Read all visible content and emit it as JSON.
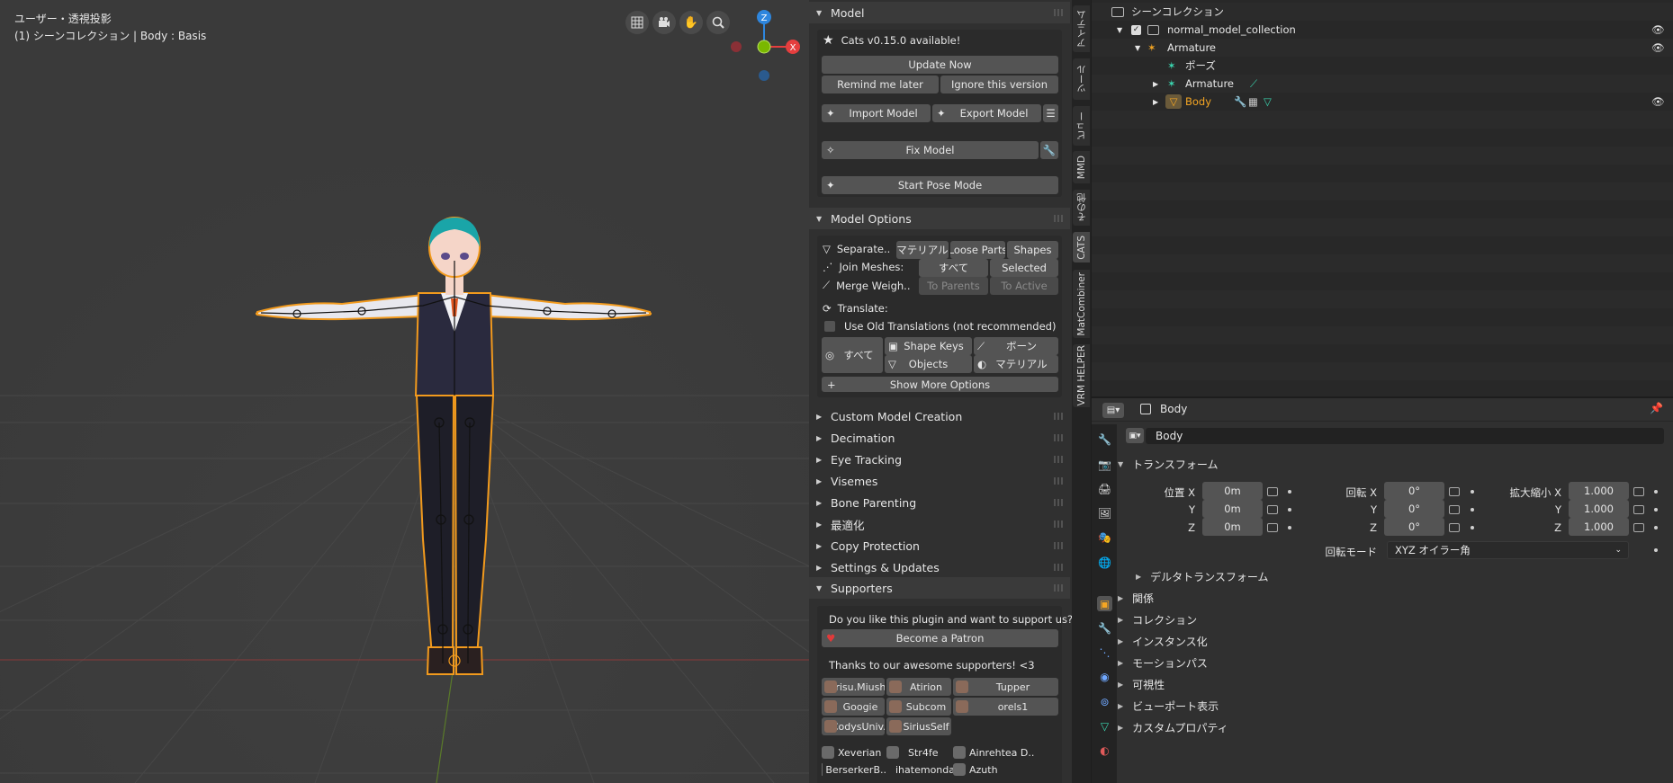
{
  "viewport": {
    "view_name": "ユーザー・透視投影",
    "context": "(1) シーンコレクション | Body : Basis",
    "gizmo": {
      "z": "Z",
      "x": "X"
    }
  },
  "npanel": {
    "model": {
      "header": "Model",
      "update_notice": "Cats v0.15.0 available!",
      "update_now": "Update Now",
      "remind_later": "Remind me later",
      "ignore_version": "Ignore this version",
      "import_model": "Import Model",
      "export_model": "Export Model",
      "fix_model": "Fix Model",
      "start_pose_mode": "Start Pose Mode"
    },
    "model_options": {
      "header": "Model Options",
      "separate_label": "Separate..",
      "separate_material": "マテリアル",
      "separate_loose": "Loose Parts",
      "separate_shapes": "Shapes",
      "join_label": "Join Meshes:",
      "join_all": "すべて",
      "join_selected": "Selected",
      "merge_label": "Merge Weigh..",
      "merge_parents": "To Parents",
      "merge_active": "To Active",
      "translate_label": "Translate:",
      "old_translations": "Use Old Translations (not recommended)",
      "translate_all": "すべて",
      "shape_keys": "Shape Keys",
      "bones": "ボーン",
      "objects": "Objects",
      "materials": "マテリアル",
      "show_more": "Show More Options"
    },
    "collapsed_sections": [
      "Custom Model Creation",
      "Decimation",
      "Eye Tracking",
      "Visemes",
      "Bone Parenting",
      "最適化",
      "Copy Protection",
      "Settings & Updates"
    ],
    "supporters": {
      "header": "Supporters",
      "question": "Do you like this plugin and want to support us?",
      "patron": "Become a Patron",
      "thanks": "Thanks to our awesome supporters! <3",
      "boxed": [
        "Krisu.Miushy",
        "Atirion",
        "Tupper",
        "Googie",
        "Subcom",
        "orels1",
        "CodysUniv..",
        "SiriusSelf"
      ],
      "plain": [
        "Xeverian",
        "Str4fe",
        "Ainrehtea D..",
        "BerserkerB..",
        "ihatemonda..",
        "Azuth"
      ]
    }
  },
  "tabs": [
    "アイテム",
    "ツール",
    "ビュー",
    "MMD",
    "その他",
    "CATS",
    "MatCombiner",
    "VRM HELPER"
  ],
  "outliner": {
    "rows": [
      {
        "label": "シーンコレクション"
      },
      {
        "label": "normal_model_collection"
      },
      {
        "label": "Armature"
      },
      {
        "label": "ポーズ"
      },
      {
        "label": "Armature"
      },
      {
        "label": "Body"
      }
    ]
  },
  "properties": {
    "header_name": "Body",
    "object_name": "Body",
    "transform_header": "トランスフォーム",
    "location_label": "位置 X",
    "rotation_label": "回転 X",
    "scale_label": "拡大縮小 X",
    "y": "Y",
    "z": "Z",
    "loc": [
      "0m",
      "0m",
      "0m"
    ],
    "rot": [
      "0°",
      "0°",
      "0°"
    ],
    "scale": [
      "1.000",
      "1.000",
      "1.000"
    ],
    "rotation_mode_label": "回転モード",
    "rotation_mode": "XYZ オイラー角",
    "delta": "デルタトランスフォーム",
    "sections": [
      "関係",
      "コレクション",
      "インスタンス化",
      "モーションパス",
      "可視性",
      "ビューポート表示",
      "カスタムプロパティ"
    ]
  },
  "colors": {
    "accent_orange": "#f5a623",
    "selected_outline": "#f0a030",
    "x_axis": "#e53e3e",
    "y_axis": "#7ab800",
    "z_axis": "#2e86de"
  }
}
